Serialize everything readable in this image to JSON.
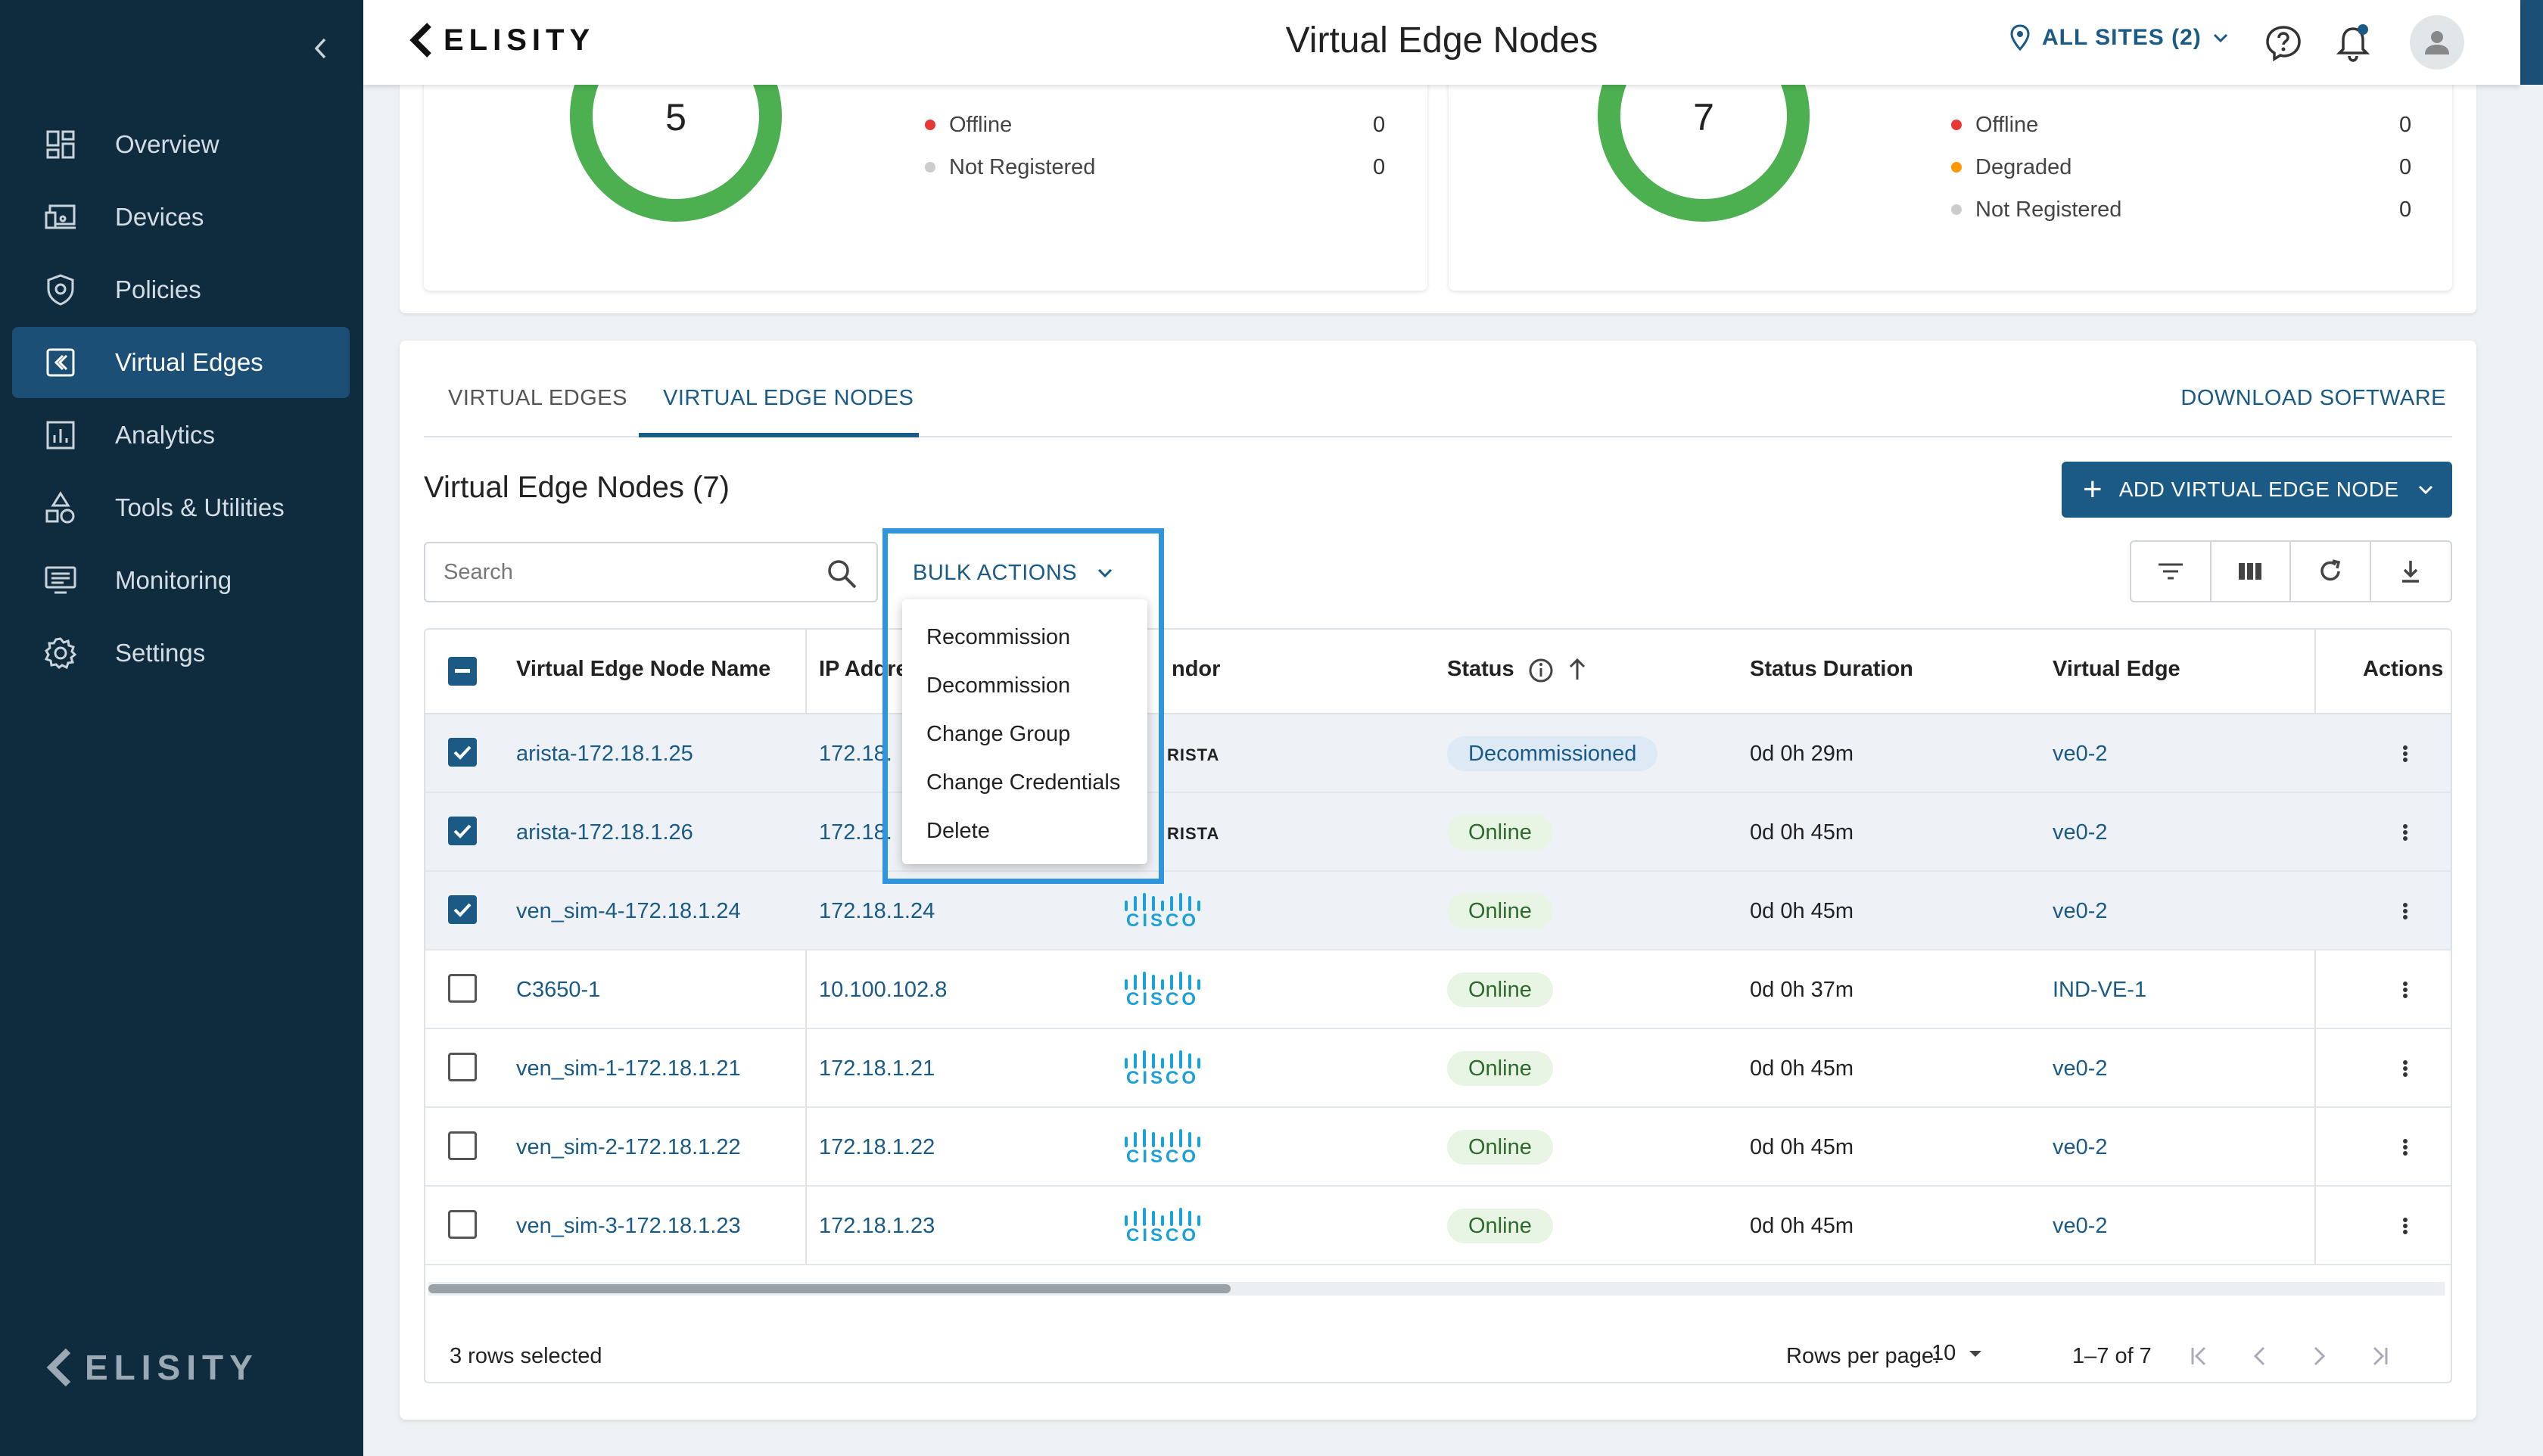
{
  "app": {
    "logo_text": "ELISITY",
    "page_title": "Virtual Edge Nodes"
  },
  "colors": {
    "sidebar": "#0f2c3f",
    "active_nav": "#1b4f76",
    "primary": "#1c5a86",
    "online": "#4caf50",
    "offline": "#e53935",
    "degraded": "#ff9800",
    "not_registered": "#cccccc",
    "highlight": "#2f95dd"
  },
  "header": {
    "site_selector": "ALL SITES (2)",
    "icons": [
      "help-icon",
      "bell-icon",
      "user-icon"
    ]
  },
  "sidebar": {
    "items": [
      {
        "label": "Overview",
        "icon": "dashboard-icon",
        "active": false
      },
      {
        "label": "Devices",
        "icon": "devices-icon",
        "active": false
      },
      {
        "label": "Policies",
        "icon": "shield-icon",
        "active": false
      },
      {
        "label": "Virtual Edges",
        "icon": "virtual-edge-icon",
        "active": true
      },
      {
        "label": "Analytics",
        "icon": "chart-icon",
        "active": false
      },
      {
        "label": "Tools & Utilities",
        "icon": "tools-icon",
        "active": false
      },
      {
        "label": "Monitoring",
        "icon": "monitor-icon",
        "active": false
      },
      {
        "label": "Settings",
        "icon": "gear-icon",
        "active": false
      }
    ],
    "footer_logo": "ELISITY"
  },
  "summary": {
    "virtual_edges": {
      "total": "5",
      "legend": [
        {
          "label": "Offline",
          "value": "0"
        },
        {
          "label": "Not Registered",
          "value": "0"
        }
      ]
    },
    "virtual_edge_nodes": {
      "total": "7",
      "legend": [
        {
          "label": "Offline",
          "value": "0"
        },
        {
          "label": "Degraded",
          "value": "0"
        },
        {
          "label": "Not Registered",
          "value": "0"
        }
      ]
    }
  },
  "tabs": [
    {
      "label": "VIRTUAL EDGES",
      "active": false
    },
    {
      "label": "VIRTUAL EDGE NODES",
      "active": true
    }
  ],
  "download_link": "DOWNLOAD SOFTWARE",
  "section_title": "Virtual Edge Nodes (7)",
  "add_button": "ADD VIRTUAL EDGE NODE",
  "search": {
    "placeholder": "Search",
    "value": ""
  },
  "bulk_actions": {
    "label": "BULK ACTIONS",
    "menu": [
      "Recommission",
      "Decommission",
      "Change Group",
      "Change Credentials",
      "Delete"
    ]
  },
  "toolbar_icons": [
    "filter-icon",
    "columns-icon",
    "refresh-icon",
    "download-icon"
  ],
  "table": {
    "columns": {
      "name": "Virtual Edge Node Name",
      "ip": "IP Addre",
      "vendor": "ndor",
      "status": "Status",
      "duration": "Status Duration",
      "edge": "Virtual Edge",
      "actions": "Actions"
    },
    "rows": [
      {
        "checked": true,
        "name": "arista-172.18.1.25",
        "ip": "172.18.",
        "vendor": "ARISTA",
        "vendor_text": "RISTA",
        "status": "Decommissioned",
        "duration": "0d 0h 29m",
        "edge": "ve0-2"
      },
      {
        "checked": true,
        "name": "arista-172.18.1.26",
        "ip": "172.18.",
        "vendor": "ARISTA",
        "vendor_text": "RISTA",
        "status": "Online",
        "duration": "0d 0h 45m",
        "edge": "ve0-2"
      },
      {
        "checked": true,
        "name": "ven_sim-4-172.18.1.24",
        "ip": "172.18.1.24",
        "vendor": "CISCO",
        "vendor_text": "CISCO",
        "status": "Online",
        "duration": "0d 0h 45m",
        "edge": "ve0-2"
      },
      {
        "checked": false,
        "name": "C3650-1",
        "ip": "10.100.102.8",
        "vendor": "CISCO",
        "vendor_text": "CISCO",
        "status": "Online",
        "duration": "0d 0h 37m",
        "edge": "IND-VE-1"
      },
      {
        "checked": false,
        "name": "ven_sim-1-172.18.1.21",
        "ip": "172.18.1.21",
        "vendor": "CISCO",
        "vendor_text": "CISCO",
        "status": "Online",
        "duration": "0d 0h 45m",
        "edge": "ve0-2"
      },
      {
        "checked": false,
        "name": "ven_sim-2-172.18.1.22",
        "ip": "172.18.1.22",
        "vendor": "CISCO",
        "vendor_text": "CISCO",
        "status": "Online",
        "duration": "0d 0h 45m",
        "edge": "ve0-2"
      },
      {
        "checked": false,
        "name": "ven_sim-3-172.18.1.23",
        "ip": "172.18.1.23",
        "vendor": "CISCO",
        "vendor_text": "CISCO",
        "status": "Online",
        "duration": "0d 0h 45m",
        "edge": "ve0-2"
      }
    ]
  },
  "footer": {
    "selected": "3 rows selected",
    "rows_per_page_label": "Rows per page:",
    "rows_per_page": "10",
    "range": "1–7 of 7"
  }
}
